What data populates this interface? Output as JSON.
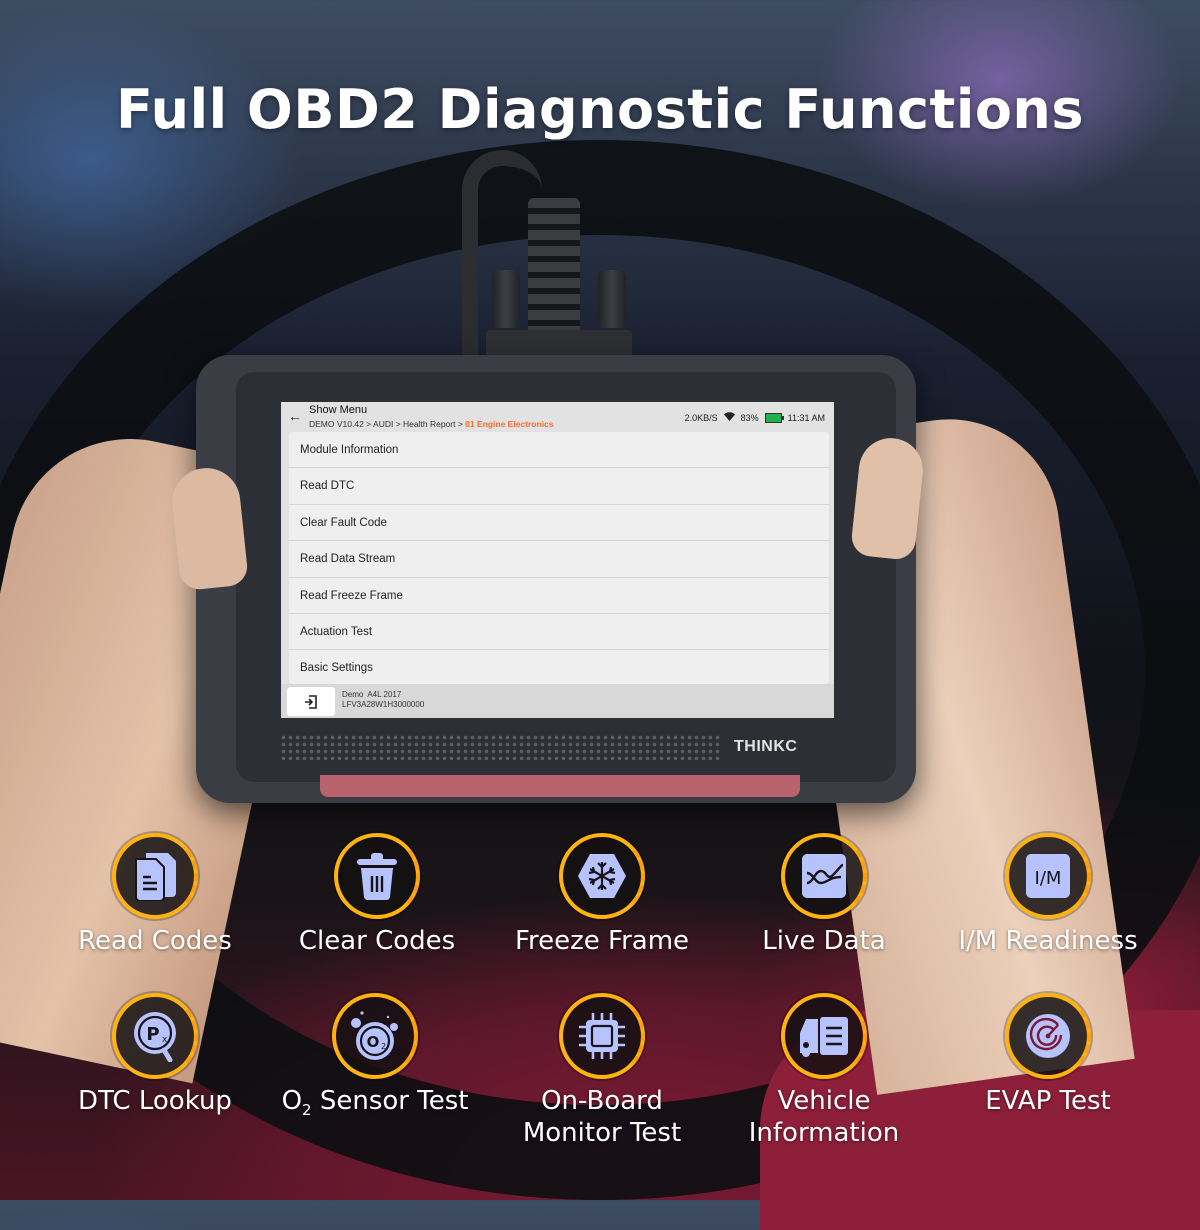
{
  "headline": "Full OBD2 Diagnostic Functions",
  "device": {
    "brand": "THINKC",
    "screen": {
      "title": "Show Menu",
      "breadcrumb": [
        "DEMO V10.42",
        "AUDI",
        "Health Report"
      ],
      "breadcrumb_sep": " > ",
      "breadcrumb_active": "01 Engine Electronics",
      "status": {
        "speed": "2.0KB/S",
        "battery": "83%",
        "time": "11:31 AM"
      },
      "menu_items": [
        {
          "label": "Module Information"
        },
        {
          "label": "Read DTC"
        },
        {
          "label": "Clear Fault Code"
        },
        {
          "label": "Read Data Stream"
        },
        {
          "label": "Read Freeze Frame"
        },
        {
          "label": "Actuation Test"
        },
        {
          "label": "Basic Settings"
        }
      ],
      "footer": {
        "vehicle": "Demo  A4L 2017",
        "vin": "LFV3A28W1H3000000"
      }
    }
  },
  "features": [
    {
      "label": "Read Codes",
      "icon": "documents-icon"
    },
    {
      "label": "Clear Codes",
      "icon": "trash-icon"
    },
    {
      "label": "Freeze Frame",
      "icon": "snowflake-icon"
    },
    {
      "label": "Live Data",
      "icon": "line-graph-icon"
    },
    {
      "label": "I/M Readiness",
      "icon": "im-badge-icon"
    },
    {
      "label": "DTC Lookup",
      "icon": "magnifier-px-icon"
    },
    {
      "label_pre": "O",
      "label_sub": "2",
      "label_post": " Sensor Test",
      "icon": "o2-bubble-icon"
    },
    {
      "label_line1": "On-Board",
      "label_line2": "Monitor Test",
      "icon": "chip-icon"
    },
    {
      "label_line1": "Vehicle",
      "label_line2": "Information",
      "icon": "vehicle-doc-icon"
    },
    {
      "label": "EVAP Test",
      "icon": "radar-icon"
    }
  ],
  "colors": {
    "accent": "#ffb30f",
    "icon_fill": "#b7c3ff",
    "breadcrumb_active": "#f26d2e",
    "battery": "#22b14c"
  }
}
